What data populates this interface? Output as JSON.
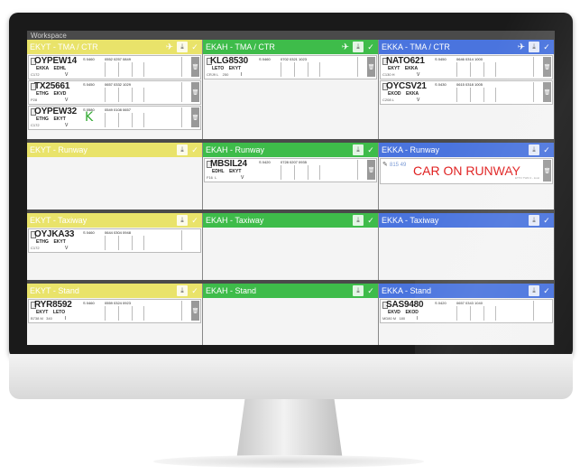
{
  "workspace_label": "Workspace",
  "colors": {
    "yellow": "#e9e36a",
    "green": "#3ebc4a",
    "blue": "#4a74de",
    "alert": "#e02020"
  },
  "icons": {
    "plane": "airplane-icon",
    "download": "download-icon",
    "check": "check-icon",
    "trash": "trash-icon"
  },
  "bays": {
    "ekyt_tma": {
      "title": "EKYT - TMA / CTR"
    },
    "ekah_tma": {
      "title": "EKAH - TMA / CTR"
    },
    "ekka_tma": {
      "title": "EKKA - TMA / CTR"
    },
    "ekyt_runway": {
      "title": "EKYT - Runway"
    },
    "ekah_runway": {
      "title": "EKAH - Runway"
    },
    "ekka_runway": {
      "title": "EKKA - Runway",
      "alert": "CAR ON RUNWAY",
      "note": "ETTO TWR-3 - local",
      "scribble": "815 49"
    },
    "ekyt_taxiway": {
      "title": "EKYT - Taxiway"
    },
    "ekah_taxiway": {
      "title": "EKAH - Taxiway"
    },
    "ekka_taxiway": {
      "title": "EKKA - Taxiway"
    },
    "ekyt_stand": {
      "title": "EKYT - Stand"
    },
    "ekah_stand": {
      "title": "EKAH - Stand"
    },
    "ekka_stand": {
      "title": "EKKA - Stand"
    }
  },
  "strips": {
    "oypew14": {
      "callsign": "OYPEW14",
      "route": "EKKA    EDHL",
      "sub": "C172",
      "code": "S 0460",
      "times": "0552 0257 0849",
      "v": "V"
    },
    "tx25661": {
      "callsign": "TX25661",
      "route": "ETHG    EKVD",
      "sub": "P28",
      "code": "S 0450",
      "times": "0657 0332 1029",
      "v": "V"
    },
    "oypew32": {
      "callsign": "OYPEW32",
      "route": "ETHG    EKYT",
      "sub": "C172",
      "code": "S 0580",
      "times": "0549 0108 0657",
      "v": "V",
      "mark": "K"
    },
    "klg8530": {
      "callsign": "KLG8530",
      "route": "LETO    EKYT",
      "sub": "CRJ9 L    250",
      "code": "S 0460",
      "times": "0702 0321 1023",
      "v": "I"
    },
    "nato621": {
      "callsign": "NATO621",
      "route": "EKYT    EKKA",
      "sub": "C130 H",
      "code": "S 0450",
      "times": "0646 0314 1000",
      "v": "V"
    },
    "oycsv21": {
      "callsign": "OYCSV21",
      "route": "EKOD    EKKA",
      "sub": "C208 L",
      "code": "S 0430",
      "times": "0615 0318 1005",
      "v": "V"
    },
    "mbsil24": {
      "callsign": "MBSIL24",
      "route": "EDHL    EKYT",
      "sub": "F16  L",
      "code": "S 0420",
      "times": "0728 0207 0935",
      "v": "V"
    },
    "oyjka33": {
      "callsign": "OYJKA33",
      "route": "ETHG    EKYT",
      "sub": "C172",
      "code": "S 0460",
      "times": "0644 0304 0948",
      "v": "V"
    },
    "ryr8592": {
      "callsign": "RYR8592",
      "route": "EKYT    LETO",
      "sub": "B738 M   340",
      "code": "S 0460",
      "times": "0559 0324 0923",
      "v": "I"
    },
    "sas9480": {
      "callsign": "SAS9480",
      "route": "EKVD    EKOD",
      "sub": "MD80 M   180",
      "code": "S 0420",
      "times": "0657 0343 1040",
      "v": "I"
    }
  }
}
